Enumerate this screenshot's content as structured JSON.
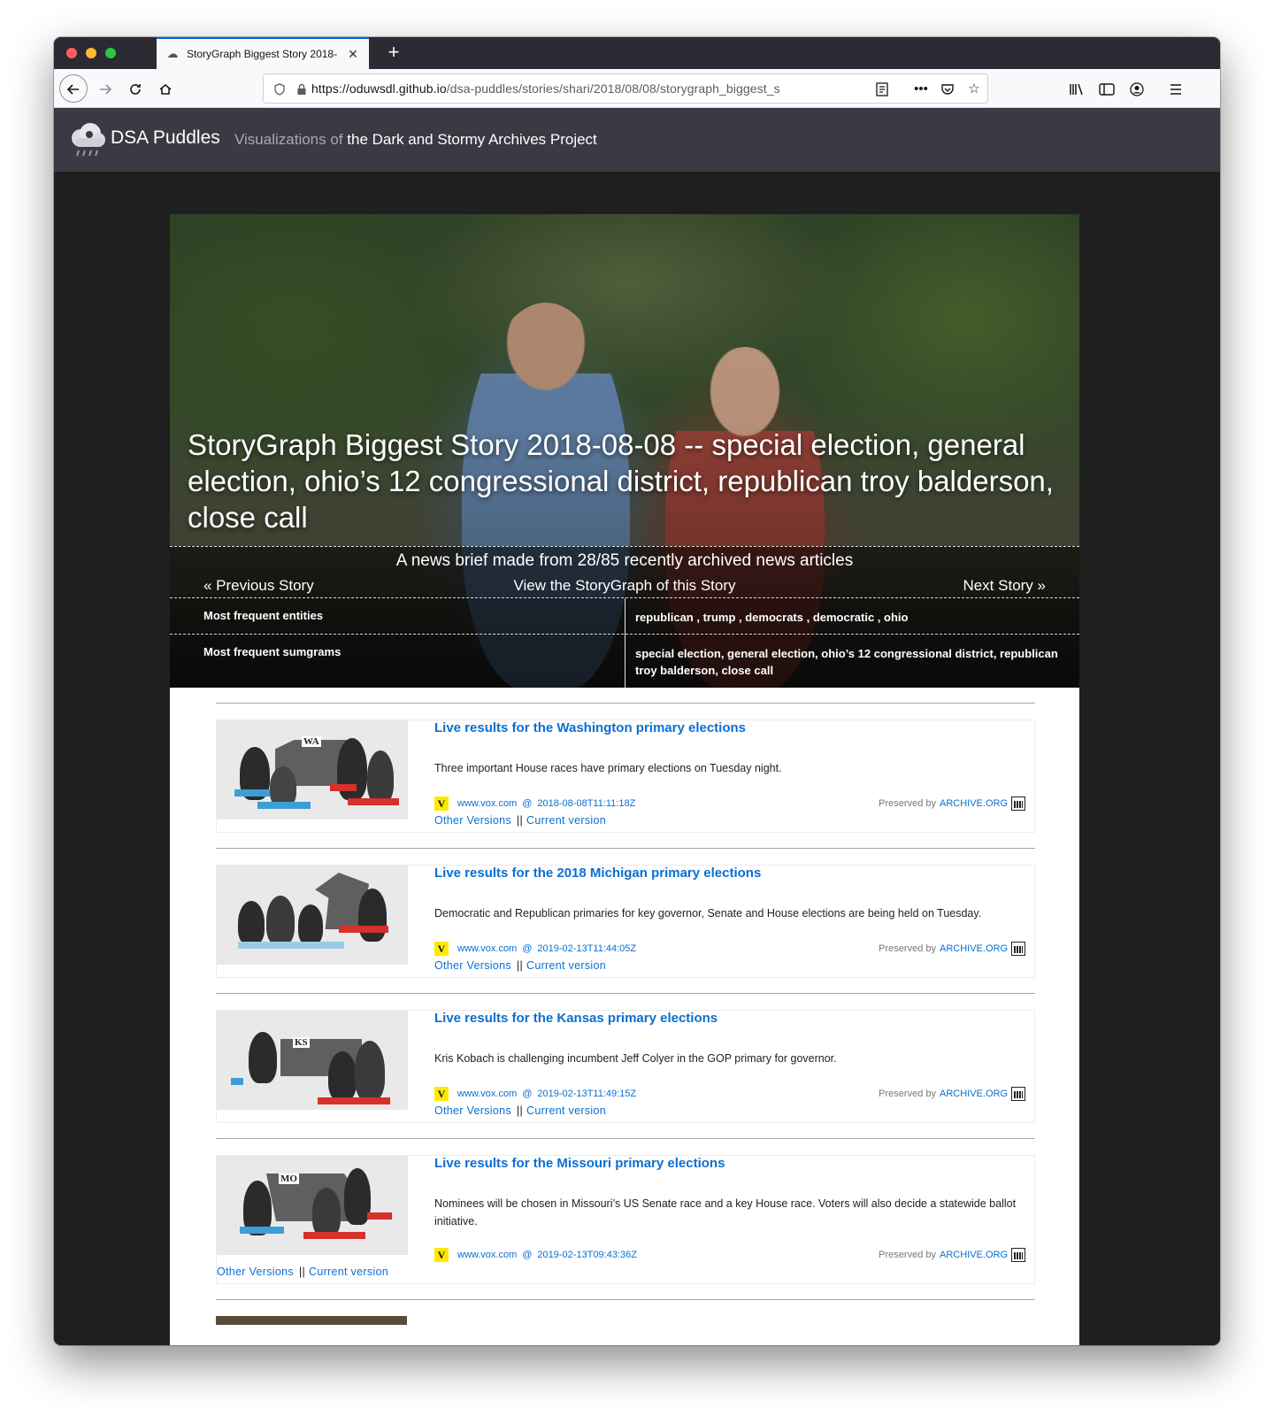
{
  "browser": {
    "tab_title": "StoryGraph Biggest Story 2018-",
    "tab_close": "✕",
    "new_tab": "+",
    "url_main": "https://oduwsdl.github.io",
    "url_path": "/dsa-puddles/stories/shari/2018/08/08/storygraph_biggest_s"
  },
  "site": {
    "brand": "DSA Puddles",
    "tagline_prefix": "Visualizations of",
    "tagline_strong": "the Dark and Stormy Archives Project"
  },
  "hero": {
    "title": "StoryGraph Biggest Story 2018-08-08 -- special election, general election, ohio’s 12 congressional district, republican troy balderson, close call",
    "brief": "A news brief made from 28/85 recently archived news articles",
    "prev": "« Previous Story",
    "view": "View the StoryGraph of this Story",
    "next": "Next Story »",
    "entities_label": "Most frequent entities",
    "entities_value": "republican , trump , democrats , democratic , ohio",
    "sumgrams_label": "Most frequent sumgrams",
    "sumgrams_value": "special election, general election, ohio’s 12 congressional district, republican troy balderson, close call"
  },
  "labels": {
    "other_versions": "Other Versions",
    "separator": "||",
    "current_version": "Current version",
    "preserved_by": "Preserved by",
    "archive_org": "ARCHIVE.ORG",
    "at": "@",
    "vox_letter": "V"
  },
  "stories": [
    {
      "title": "Live results for the Washington primary elections",
      "description": "Three important House races have primary elections on Tuesday night.",
      "source": "www.vox.com",
      "datetime": "2018-08-08T11:11:18Z",
      "state": "WA"
    },
    {
      "title": "Live results for the 2018 Michigan primary elections",
      "description": "Democratic and Republican primaries for key governor, Senate and House elections are being held on Tuesday.",
      "source": "www.vox.com",
      "datetime": "2019-02-13T11:44:05Z",
      "state": ""
    },
    {
      "title": "Live results for the Kansas primary elections",
      "description": "Kris Kobach is challenging incumbent Jeff Colyer in the GOP primary for governor.",
      "source": "www.vox.com",
      "datetime": "2019-02-13T11:49:15Z",
      "state": "KS"
    },
    {
      "title": "Live results for the Missouri primary elections",
      "description": "Nominees will be chosen in Missouri’s US Senate race and a key House race. Voters will also decide a statewide ballot initiative.",
      "source": "www.vox.com",
      "datetime": "2019-02-13T09:43:36Z",
      "state": "MO"
    }
  ]
}
